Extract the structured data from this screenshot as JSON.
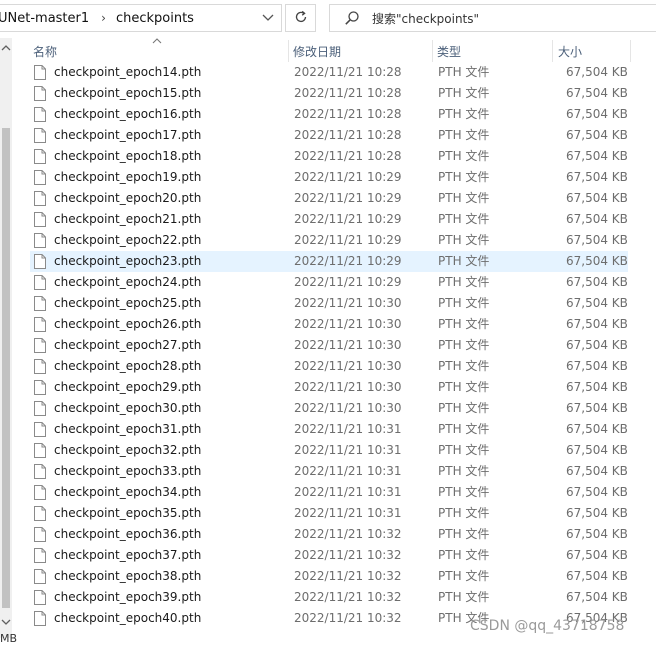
{
  "address_bar": {
    "crumbs": [
      "UNet-master1",
      "checkpoints"
    ],
    "separator": "›"
  },
  "search": {
    "placeholder": "搜索\"checkpoints\""
  },
  "columns": {
    "name": "名称",
    "date": "修改日期",
    "type": "类型",
    "size": "大小"
  },
  "files": [
    {
      "name": "checkpoint_epoch14.pth",
      "date": "2022/11/21 10:28",
      "type": "PTH 文件",
      "size": "67,504 KB"
    },
    {
      "name": "checkpoint_epoch15.pth",
      "date": "2022/11/21 10:28",
      "type": "PTH 文件",
      "size": "67,504 KB"
    },
    {
      "name": "checkpoint_epoch16.pth",
      "date": "2022/11/21 10:28",
      "type": "PTH 文件",
      "size": "67,504 KB"
    },
    {
      "name": "checkpoint_epoch17.pth",
      "date": "2022/11/21 10:28",
      "type": "PTH 文件",
      "size": "67,504 KB"
    },
    {
      "name": "checkpoint_epoch18.pth",
      "date": "2022/11/21 10:28",
      "type": "PTH 文件",
      "size": "67,504 KB"
    },
    {
      "name": "checkpoint_epoch19.pth",
      "date": "2022/11/21 10:29",
      "type": "PTH 文件",
      "size": "67,504 KB"
    },
    {
      "name": "checkpoint_epoch20.pth",
      "date": "2022/11/21 10:29",
      "type": "PTH 文件",
      "size": "67,504 KB"
    },
    {
      "name": "checkpoint_epoch21.pth",
      "date": "2022/11/21 10:29",
      "type": "PTH 文件",
      "size": "67,504 KB"
    },
    {
      "name": "checkpoint_epoch22.pth",
      "date": "2022/11/21 10:29",
      "type": "PTH 文件",
      "size": "67,504 KB"
    },
    {
      "name": "checkpoint_epoch23.pth",
      "date": "2022/11/21 10:29",
      "type": "PTH 文件",
      "size": "67,504 KB",
      "selected": true
    },
    {
      "name": "checkpoint_epoch24.pth",
      "date": "2022/11/21 10:29",
      "type": "PTH 文件",
      "size": "67,504 KB"
    },
    {
      "name": "checkpoint_epoch25.pth",
      "date": "2022/11/21 10:30",
      "type": "PTH 文件",
      "size": "67,504 KB"
    },
    {
      "name": "checkpoint_epoch26.pth",
      "date": "2022/11/21 10:30",
      "type": "PTH 文件",
      "size": "67,504 KB"
    },
    {
      "name": "checkpoint_epoch27.pth",
      "date": "2022/11/21 10:30",
      "type": "PTH 文件",
      "size": "67,504 KB"
    },
    {
      "name": "checkpoint_epoch28.pth",
      "date": "2022/11/21 10:30",
      "type": "PTH 文件",
      "size": "67,504 KB"
    },
    {
      "name": "checkpoint_epoch29.pth",
      "date": "2022/11/21 10:30",
      "type": "PTH 文件",
      "size": "67,504 KB"
    },
    {
      "name": "checkpoint_epoch30.pth",
      "date": "2022/11/21 10:30",
      "type": "PTH 文件",
      "size": "67,504 KB"
    },
    {
      "name": "checkpoint_epoch31.pth",
      "date": "2022/11/21 10:31",
      "type": "PTH 文件",
      "size": "67,504 KB"
    },
    {
      "name": "checkpoint_epoch32.pth",
      "date": "2022/11/21 10:31",
      "type": "PTH 文件",
      "size": "67,504 KB"
    },
    {
      "name": "checkpoint_epoch33.pth",
      "date": "2022/11/21 10:31",
      "type": "PTH 文件",
      "size": "67,504 KB"
    },
    {
      "name": "checkpoint_epoch34.pth",
      "date": "2022/11/21 10:31",
      "type": "PTH 文件",
      "size": "67,504 KB"
    },
    {
      "name": "checkpoint_epoch35.pth",
      "date": "2022/11/21 10:31",
      "type": "PTH 文件",
      "size": "67,504 KB"
    },
    {
      "name": "checkpoint_epoch36.pth",
      "date": "2022/11/21 10:32",
      "type": "PTH 文件",
      "size": "67,504 KB"
    },
    {
      "name": "checkpoint_epoch37.pth",
      "date": "2022/11/21 10:32",
      "type": "PTH 文件",
      "size": "67,504 KB"
    },
    {
      "name": "checkpoint_epoch38.pth",
      "date": "2022/11/21 10:32",
      "type": "PTH 文件",
      "size": "67,504 KB"
    },
    {
      "name": "checkpoint_epoch39.pth",
      "date": "2022/11/21 10:32",
      "type": "PTH 文件",
      "size": "67,504 KB"
    },
    {
      "name": "checkpoint_epoch40.pth",
      "date": "2022/11/21 10:32",
      "type": "PTH 文件",
      "size": "67,504 KB"
    }
  ],
  "status": {
    "left_text": "MB"
  },
  "watermark": "CSDN @qq_43718758",
  "colors": {
    "selected_row": "#e5f3ff",
    "header_text": "#4c607a",
    "scrollbar_thumb": "#c2c2c2"
  },
  "icons": {
    "address_dropdown": "chevron-down-icon",
    "refresh": "refresh-icon",
    "search": "search-icon",
    "file": "file-icon",
    "scroll_up": "arrow-up-icon",
    "scroll_down": "arrow-down-icon",
    "sort": "sort-ascending-icon"
  }
}
